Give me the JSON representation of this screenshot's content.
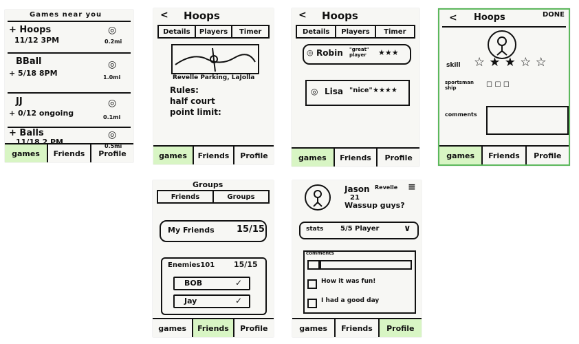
{
  "games": {
    "title": "Games near you",
    "items": [
      {
        "name": "+ Hoops",
        "time": "11/12 3PM",
        "dist": "0.2mi"
      },
      {
        "name": "BBall",
        "time": "+ 5/18 8PM",
        "dist": "1.0mi"
      },
      {
        "name": "JJ",
        "time": "+ 0/12 ongoing",
        "dist": "0.1mi"
      },
      {
        "name": "+ Balls",
        "time": "11/18 2 PM",
        "dist": "0.5mi"
      }
    ]
  },
  "nav": {
    "games": "games",
    "friends": "Friends",
    "profile": "Profile"
  },
  "hoops_details": {
    "back": "<",
    "title": "Hoops",
    "tabs": [
      "Details",
      "Players",
      "Timer"
    ],
    "location": "Revelle Parking, LaJolla",
    "rules_label": "Rules:",
    "rule1": "half court",
    "rule2": "point limit:"
  },
  "hoops_players": {
    "back": "<",
    "title": "Hoops",
    "tabs": [
      "Details",
      "Players",
      "Timer"
    ],
    "p1_name": "Robin",
    "p1_nick": "\"great\" player",
    "p1_stars": "★★★",
    "p2_name": "Lisa",
    "p2_nick": "\"nice\"",
    "p2_stars": "★★★★"
  },
  "hoops_rate": {
    "back": "<",
    "title": "Hoops",
    "done": "DONE",
    "skill_label": "skill",
    "skill_stars": "☆ ★ ★ ☆ ☆",
    "sports_label": "sportsman ship",
    "sports_marks": "☐ ☐ ☐",
    "comments_label": "comments"
  },
  "groups": {
    "title": "Groups",
    "tabs": [
      "Friends",
      "Groups"
    ],
    "g1_name": "My Friends",
    "g1_count": "15/15",
    "g2_name": "Enemies101",
    "g2_count": "15/15",
    "m1": "BOB",
    "m2": "Jay"
  },
  "profile": {
    "name": "Jason",
    "college": "Revelle",
    "age": "21",
    "status": "Wassup guys?",
    "menu": "≡",
    "stats_label": "stats",
    "stats_value": "5/5 Player",
    "comments_label": "comments",
    "c1": "",
    "c2": "How it was fun!",
    "c3": "I had a good day"
  }
}
